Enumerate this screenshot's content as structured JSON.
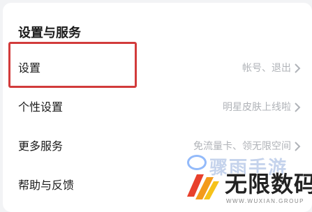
{
  "section": {
    "title": "设置与服务"
  },
  "rows": [
    {
      "label": "设置",
      "value": "帐号、退出"
    },
    {
      "label": "个性设置",
      "value": "明星皮肤上线啦"
    },
    {
      "label": "更多服务",
      "value": "免流量卡、领无限空间"
    },
    {
      "label": "帮助与反馈",
      "value": ""
    }
  ],
  "watermark": {
    "faint_text": "骤雨手游",
    "main_text": "无限数码",
    "url": "WWW.WUXIAN.GROUP"
  },
  "colors": {
    "highlight": "#d23b3b",
    "value_text": "#b0b3b8",
    "background": "#f2f3f5"
  }
}
